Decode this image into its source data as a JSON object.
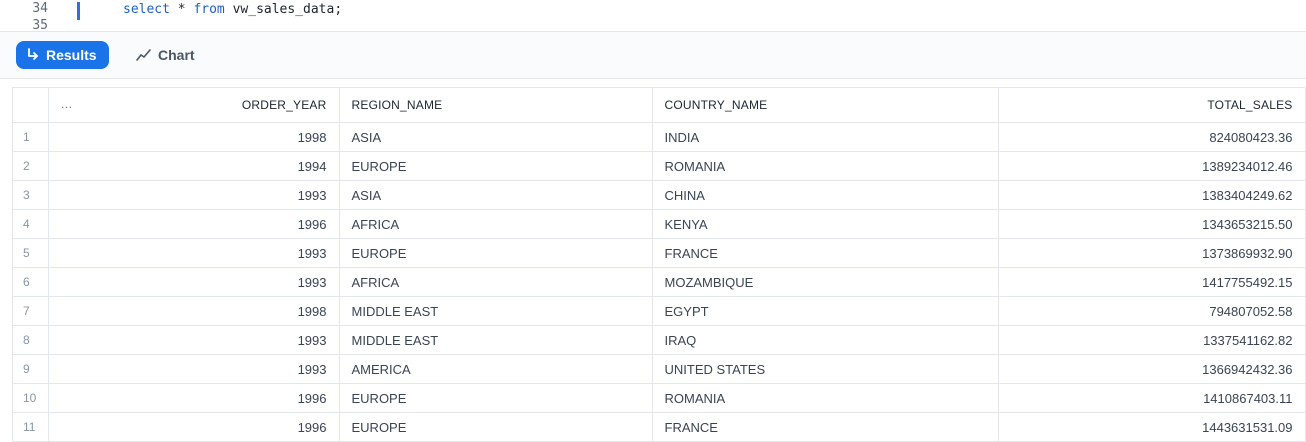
{
  "editor": {
    "lines": [
      {
        "number": "34",
        "kw1": "select",
        "rest1": " * ",
        "kw2": "from",
        "rest2": " vw_sales_data;"
      },
      {
        "number": "35"
      }
    ]
  },
  "toolbar": {
    "results_label": "Results",
    "chart_label": "Chart",
    "accent": "#1a73e8"
  },
  "table": {
    "row_header": "…",
    "columns": [
      "ORDER_YEAR",
      "REGION_NAME",
      "COUNTRY_NAME",
      "TOTAL_SALES"
    ],
    "rows": [
      [
        "1",
        "1998",
        "ASIA",
        "INDIA",
        "824080423.36"
      ],
      [
        "2",
        "1994",
        "EUROPE",
        "ROMANIA",
        "1389234012.46"
      ],
      [
        "3",
        "1993",
        "ASIA",
        "CHINA",
        "1383404249.62"
      ],
      [
        "4",
        "1996",
        "AFRICA",
        "KENYA",
        "1343653215.50"
      ],
      [
        "5",
        "1993",
        "EUROPE",
        "FRANCE",
        "1373869932.90"
      ],
      [
        "6",
        "1993",
        "AFRICA",
        "MOZAMBIQUE",
        "1417755492.15"
      ],
      [
        "7",
        "1998",
        "MIDDLE EAST",
        "EGYPT",
        "794807052.58"
      ],
      [
        "8",
        "1993",
        "MIDDLE EAST",
        "IRAQ",
        "1337541162.82"
      ],
      [
        "9",
        "1993",
        "AMERICA",
        "UNITED STATES",
        "1366942432.36"
      ],
      [
        "10",
        "1996",
        "EUROPE",
        "ROMANIA",
        "1410867403.11"
      ],
      [
        "11",
        "1996",
        "EUROPE",
        "FRANCE",
        "1443631531.09"
      ]
    ]
  }
}
